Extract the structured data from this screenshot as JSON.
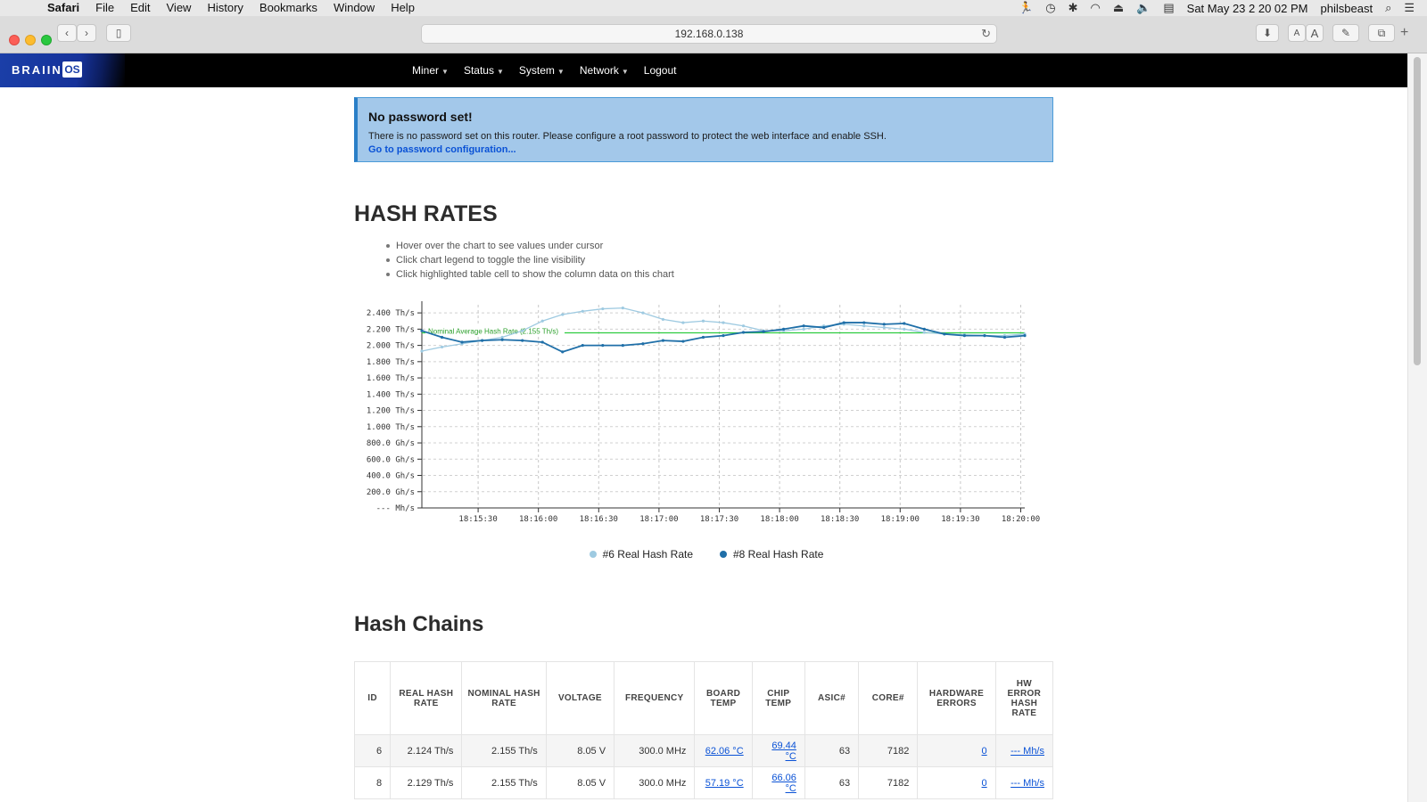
{
  "menubar": {
    "app": "Safari",
    "items": [
      "File",
      "Edit",
      "View",
      "History",
      "Bookmarks",
      "Window",
      "Help"
    ],
    "clock": "Sat May 23  2 20 02 PM",
    "user": "philsbeast"
  },
  "browser": {
    "url": "192.168.0.138",
    "font_small": "A",
    "font_large": "A"
  },
  "site": {
    "logo_text": "BRAIINS",
    "logo_os": "OS",
    "nav": [
      {
        "label": "Miner"
      },
      {
        "label": "Status"
      },
      {
        "label": "System"
      },
      {
        "label": "Network"
      },
      {
        "label": "Logout"
      }
    ]
  },
  "alert": {
    "title": "No password set!",
    "text": "There is no password set on this router. Please configure a root password to protect the web interface and enable SSH.",
    "link": "Go to password configuration..."
  },
  "hash_rates": {
    "title": "HASH RATES",
    "hints": [
      "Hover over the chart to see values under cursor",
      "Click chart legend to toggle the line visibility",
      "Click highlighted table cell to show the column data on this chart"
    ]
  },
  "chart_data": {
    "type": "line",
    "x_ticks": [
      "18:15:30",
      "18:16:00",
      "18:16:30",
      "18:17:00",
      "18:17:30",
      "18:18:00",
      "18:18:30",
      "18:19:00",
      "18:19:30",
      "18:20:00"
    ],
    "y_ticks": [
      "2.400 Th/s",
      "2.200 Th/s",
      "2.000 Th/s",
      "1.800 Th/s",
      "1.600 Th/s",
      "1.400 Th/s",
      "1.200 Th/s",
      "1.000 Th/s",
      "800.0 Gh/s",
      "600.0 Gh/s",
      "400.0 Gh/s",
      "200.0 Gh/s",
      "--- Mh/s"
    ],
    "ylim": [
      0,
      2.5
    ],
    "xlim": [
      0,
      300
    ],
    "time_start": "18:15:02",
    "reference_line": {
      "label": "Nominal Average Hash Rate (2.155 Th/s)",
      "value": 2.155
    },
    "series": [
      {
        "name": "#6 Real Hash Rate",
        "color": "#9ecae1",
        "x": [
          0,
          10,
          20,
          30,
          40,
          50,
          60,
          70,
          80,
          90,
          100,
          110,
          120,
          130,
          140,
          150,
          160,
          170,
          180,
          190,
          200,
          210,
          220,
          230,
          240,
          250,
          260,
          270,
          280,
          290,
          300
        ],
        "values": [
          1.93,
          1.98,
          2.02,
          2.06,
          2.1,
          2.18,
          2.3,
          2.38,
          2.42,
          2.45,
          2.46,
          2.4,
          2.32,
          2.28,
          2.3,
          2.28,
          2.24,
          2.18,
          2.18,
          2.2,
          2.24,
          2.26,
          2.24,
          2.22,
          2.2,
          2.16,
          2.14,
          2.13,
          2.12,
          2.12,
          2.14
        ]
      },
      {
        "name": "#8 Real Hash Rate",
        "color": "#1f6fa8",
        "x": [
          0,
          10,
          20,
          30,
          40,
          50,
          60,
          70,
          80,
          90,
          100,
          110,
          120,
          130,
          140,
          150,
          160,
          170,
          180,
          190,
          200,
          210,
          220,
          230,
          240,
          250,
          260,
          270,
          280,
          290,
          300
        ],
        "values": [
          2.18,
          2.1,
          2.04,
          2.06,
          2.07,
          2.06,
          2.04,
          1.92,
          2.0,
          2.0,
          2.0,
          2.02,
          2.06,
          2.05,
          2.1,
          2.12,
          2.16,
          2.17,
          2.2,
          2.24,
          2.22,
          2.28,
          2.28,
          2.26,
          2.27,
          2.2,
          2.14,
          2.12,
          2.12,
          2.1,
          2.12
        ]
      }
    ]
  },
  "hash_chains": {
    "title": "Hash Chains",
    "columns": [
      "ID",
      "REAL HASH RATE",
      "NOMINAL HASH RATE",
      "VOLTAGE",
      "FREQUENCY",
      "BOARD TEMP",
      "CHIP TEMP",
      "ASIC#",
      "CORE#",
      "HARDWARE ERRORS",
      "HW ERROR HASH RATE"
    ],
    "rows": [
      {
        "id": "6",
        "real": "2.124 Th/s",
        "nominal": "2.155 Th/s",
        "voltage": "8.05 V",
        "frequency": "300.0 MHz",
        "board_temp": "62.06 °C",
        "chip_temp": "69.44 °C",
        "asic": "63",
        "core": "7182",
        "hw_errors": "0",
        "hw_error_rate": "--- Mh/s"
      },
      {
        "id": "8",
        "real": "2.129 Th/s",
        "nominal": "2.155 Th/s",
        "voltage": "8.05 V",
        "frequency": "300.0 MHz",
        "board_temp": "57.19 °C",
        "chip_temp": "66.06 °C",
        "asic": "63",
        "core": "7182",
        "hw_errors": "0",
        "hw_error_rate": "--- Mh/s"
      }
    ]
  }
}
